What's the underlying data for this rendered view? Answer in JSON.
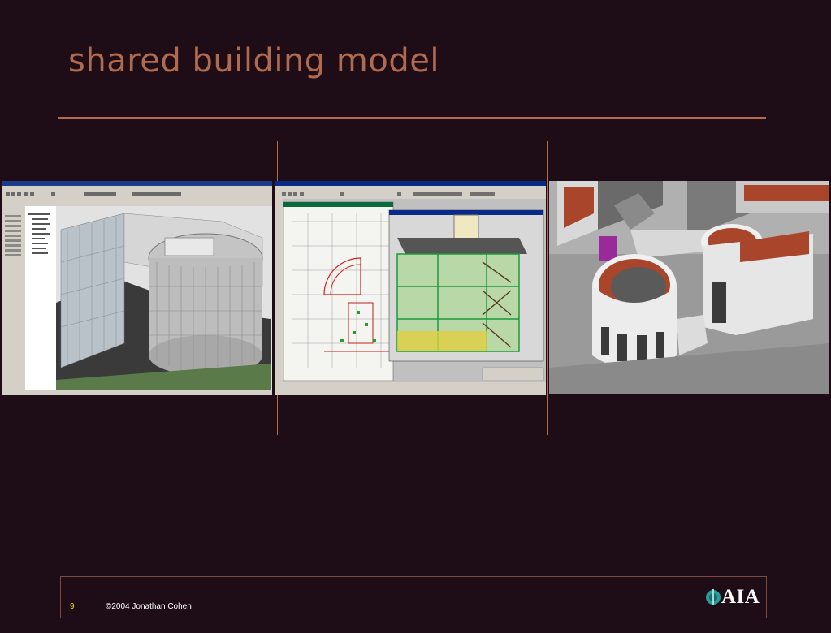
{
  "slide": {
    "title": "shared building model",
    "page_number": "9",
    "copyright": "©2004 Jonathan Cohen",
    "logo_text": "AIA"
  },
  "colors": {
    "background": "#1e0d16",
    "accent": "#b06a4e",
    "page_number": "#ffd700"
  },
  "images": [
    {
      "name": "revit-screenshot",
      "icon": "cad-app-window"
    },
    {
      "name": "archicad-screenshot",
      "icon": "cad-app-window"
    },
    {
      "name": "render-3d-model",
      "icon": "rendered-building"
    }
  ]
}
